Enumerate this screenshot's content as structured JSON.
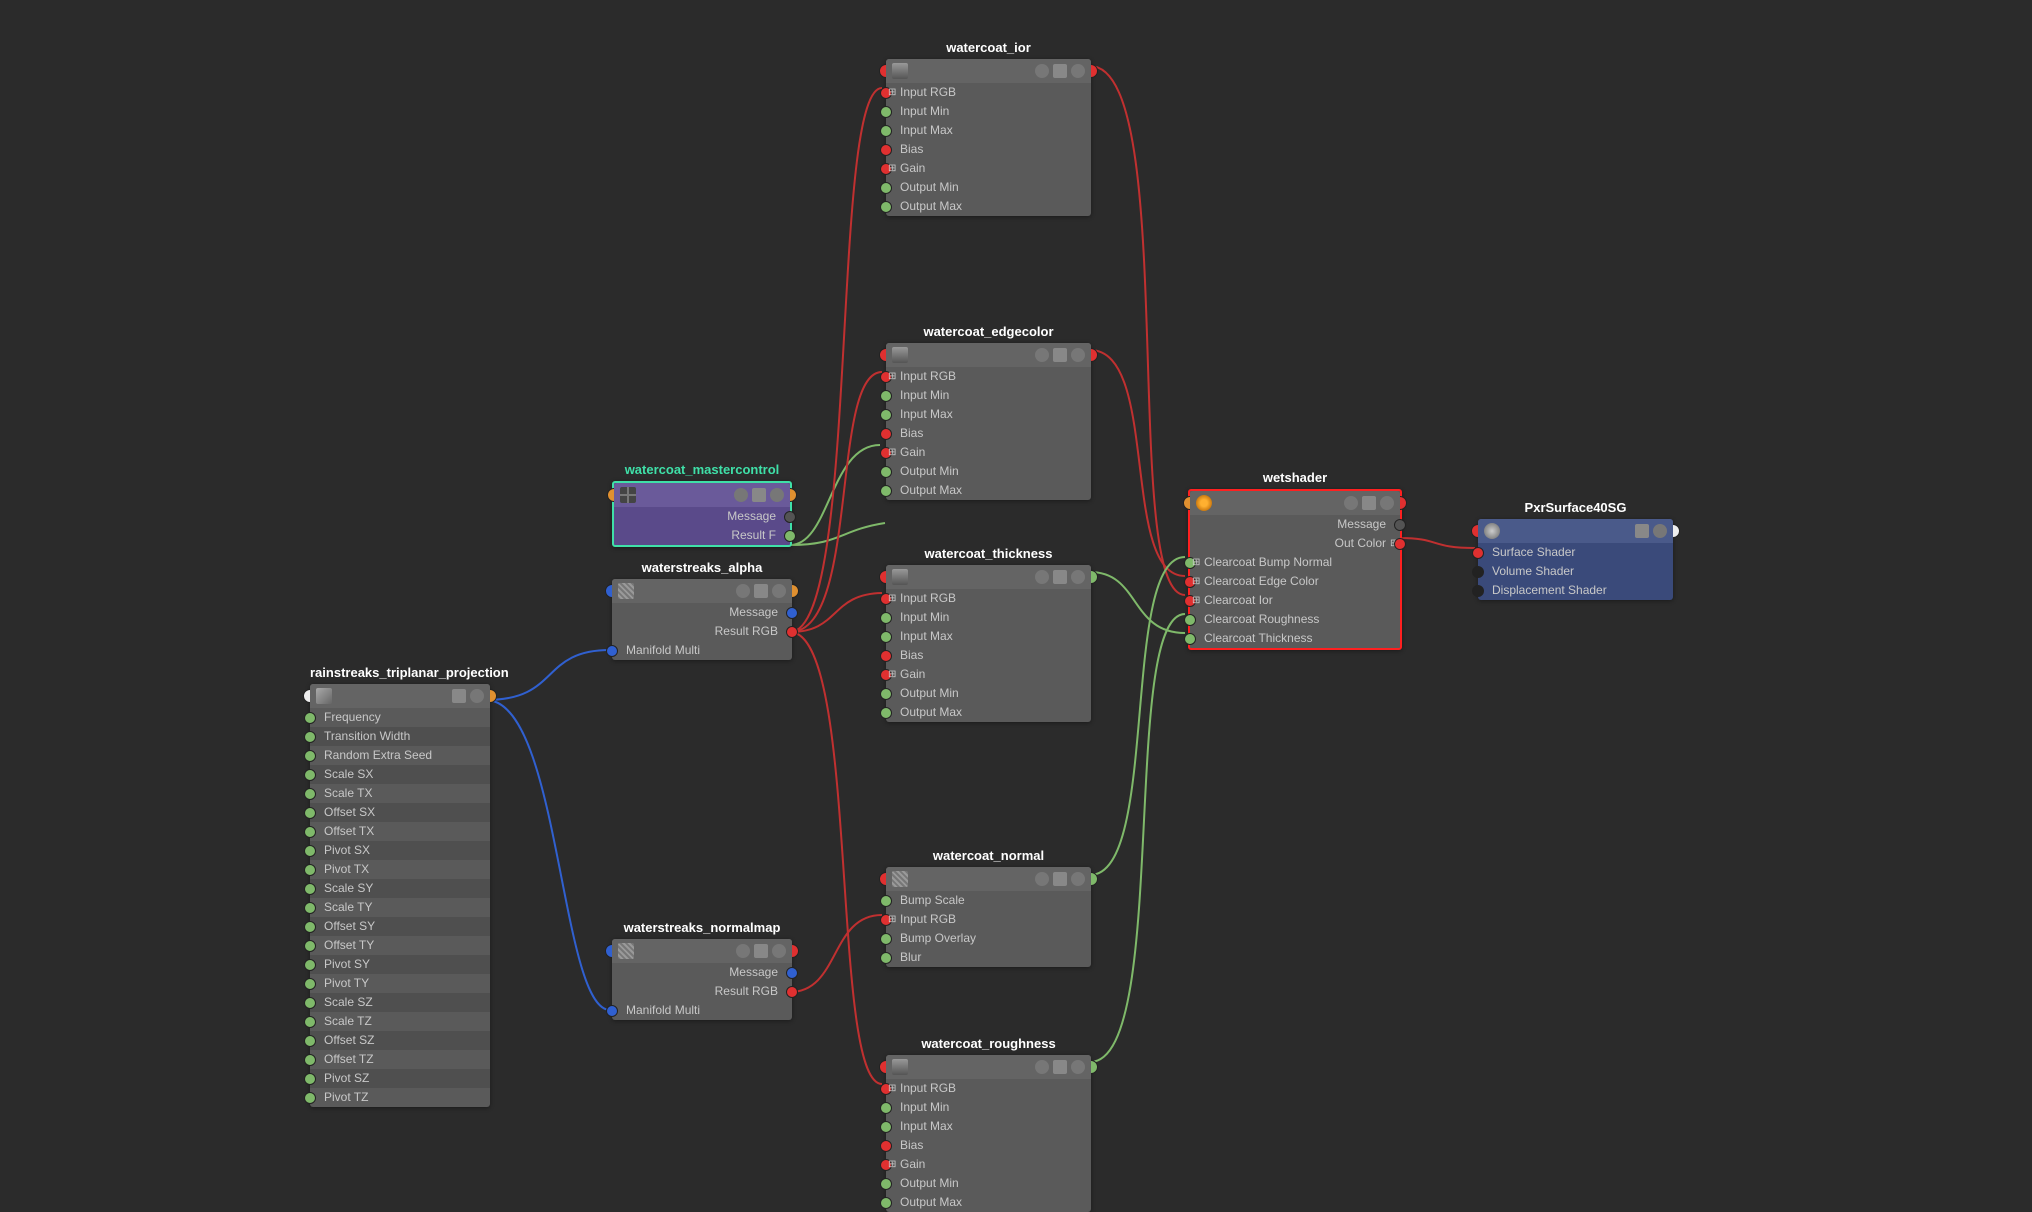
{
  "nodes": {
    "rainstreaks": {
      "title": "rainstreaks_triplanar_projection",
      "params": [
        "Frequency",
        "Transition Width",
        "Random Extra Seed",
        "Scale SX",
        "Scale TX",
        "Offset SX",
        "Offset TX",
        "Pivot SX",
        "Pivot TX",
        "Scale SY",
        "Scale TY",
        "Offset SY",
        "Offset TY",
        "Pivot SY",
        "Pivot TY",
        "Scale SZ",
        "Scale TZ",
        "Offset SZ",
        "Offset TZ",
        "Pivot SZ",
        "Pivot TZ"
      ]
    },
    "mastercontrol": {
      "title": "watercoat_mastercontrol",
      "outputs": [
        "Message",
        "Result F"
      ]
    },
    "ws_alpha": {
      "title": "waterstreaks_alpha",
      "outputs": [
        "Message",
        "Result RGB"
      ],
      "inputs": [
        "Manifold Multi"
      ]
    },
    "ws_normal": {
      "title": "waterstreaks_normalmap",
      "outputs": [
        "Message",
        "Result RGB"
      ],
      "inputs": [
        "Manifold Multi"
      ]
    },
    "remap": {
      "params": [
        "Input RGB",
        "Input Min",
        "Input Max",
        "Bias",
        "Gain",
        "Output Min",
        "Output Max"
      ]
    },
    "wc_ior": {
      "title": "watercoat_ior"
    },
    "wc_edge": {
      "title": "watercoat_edgecolor"
    },
    "wc_thick": {
      "title": "watercoat_thickness"
    },
    "wc_rough": {
      "title": "watercoat_roughness"
    },
    "wc_normal": {
      "title": "watercoat_normal",
      "params": [
        "Bump Scale",
        "Input RGB",
        "Bump Overlay",
        "Blur"
      ]
    },
    "wetshader": {
      "title": "wetshader",
      "outputs": [
        "Message",
        "Out Color"
      ],
      "inputs": [
        "Clearcoat Bump Normal",
        "Clearcoat Edge Color",
        "Clearcoat Ior",
        "Clearcoat Roughness",
        "Clearcoat Thickness"
      ]
    },
    "sg": {
      "title": "PxrSurface40SG",
      "inputs": [
        "Surface Shader",
        "Volume Shader",
        "Displacement Shader"
      ]
    }
  }
}
